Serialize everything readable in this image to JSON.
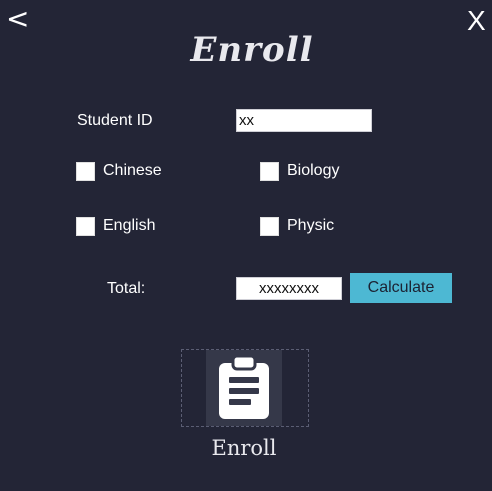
{
  "window": {
    "back_label": "<",
    "close_label": "X",
    "title": "Enroll"
  },
  "form": {
    "student_id_label": "Student ID",
    "student_id_value": "xx",
    "subjects": [
      {
        "label": "Chinese",
        "checked": false
      },
      {
        "label": "Biology",
        "checked": false
      },
      {
        "label": "English",
        "checked": false
      },
      {
        "label": "Physic",
        "checked": false
      }
    ],
    "total_label": "Total:",
    "total_value": "xxxxxxxx",
    "calculate_label": "Calculate"
  },
  "enroll_tile": {
    "icon": "clipboard-icon",
    "caption": "Enroll"
  },
  "colors": {
    "background": "#232536",
    "accent": "#4db8d3",
    "tile": "#353849"
  }
}
